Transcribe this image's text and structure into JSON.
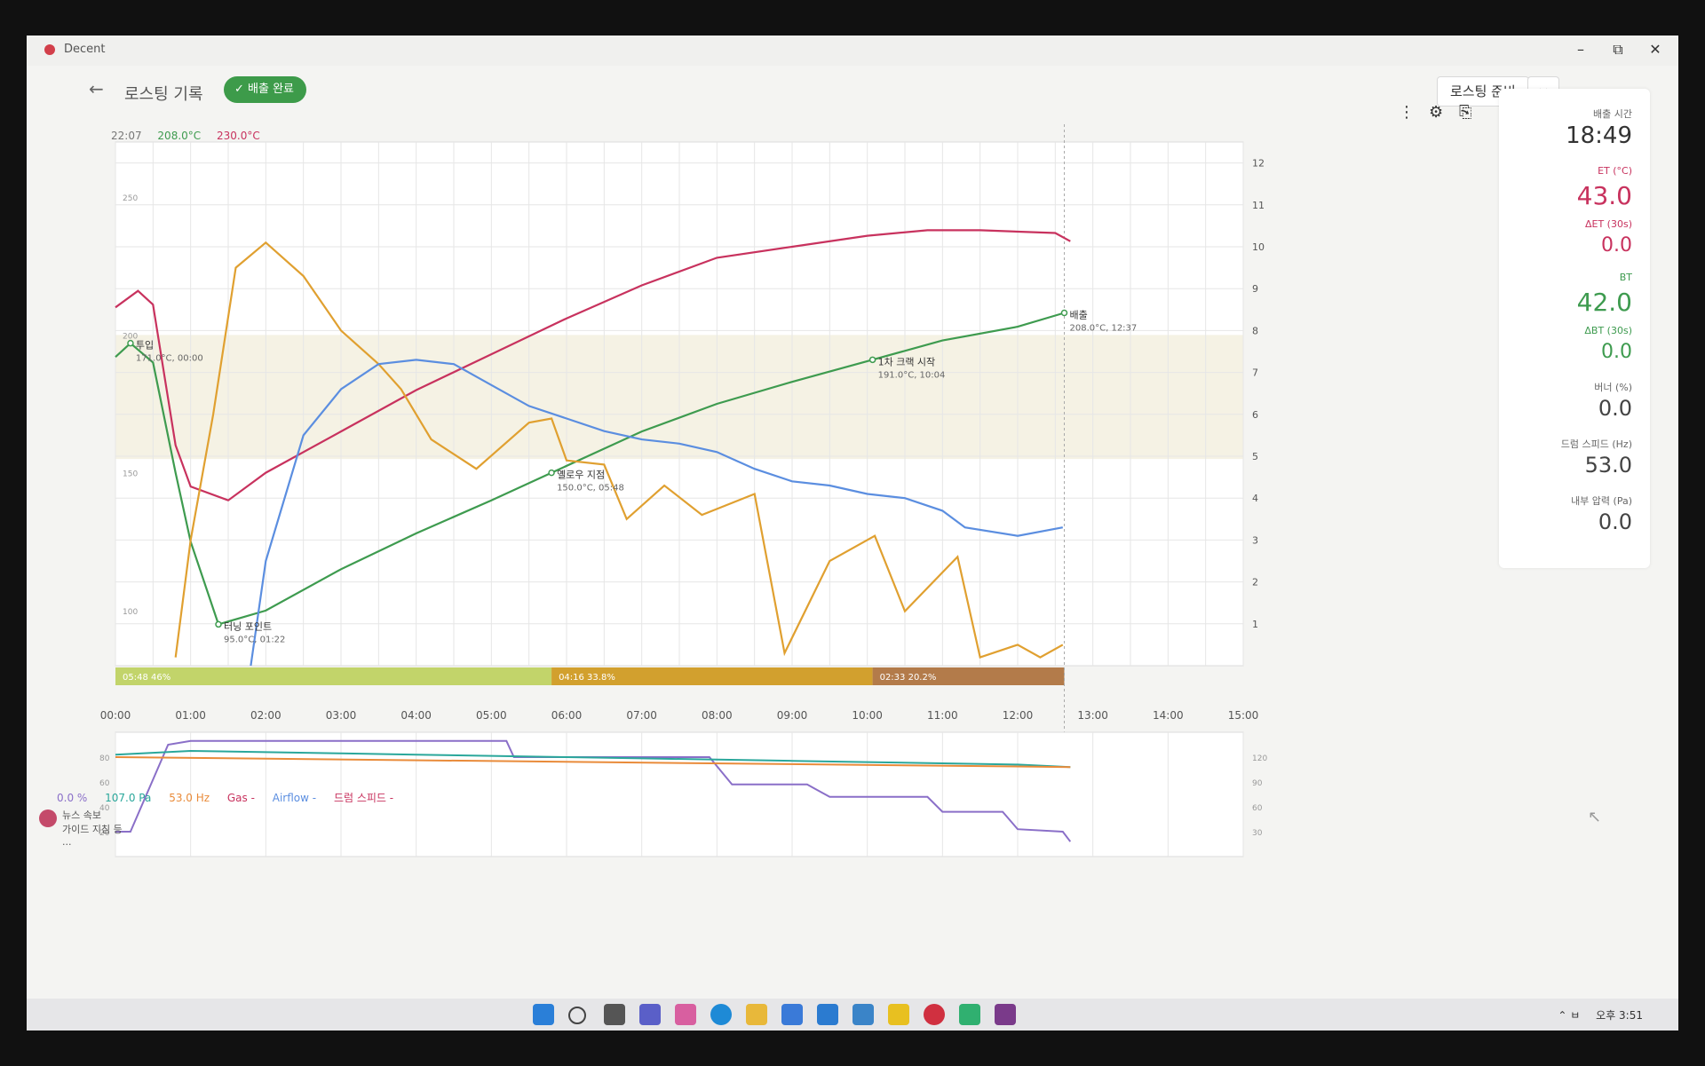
{
  "app": {
    "title": "Decent"
  },
  "window_controls": {
    "minimize": "–",
    "maximize": "⧉",
    "close": "✕"
  },
  "header": {
    "back": "←",
    "title": "로스팅 기록",
    "badge": "배출 완료",
    "prep_button": "로스팅 준비",
    "expand_button": "‹ ›"
  },
  "readout": {
    "time": "22:07",
    "et": "208.0°C",
    "bt": "230.0°C"
  },
  "toolbar": {
    "more": "⋮",
    "settings": "⚙",
    "export": "⎘"
  },
  "panel": {
    "roast_time_label": "배출 시간",
    "roast_time": "18:49",
    "et_label": "ET (°C)",
    "et": "43.0",
    "det_label": "ΔET (30s)",
    "det": "0.0",
    "bt_label": "BT",
    "bt": "42.0",
    "dbt_label": "ΔBT (30s)",
    "dbt": "0.0",
    "burner_label": "버너 (%)",
    "burner": "0.0",
    "drum_label": "드럼 스피드 (Hz)",
    "drum": "53.0",
    "pressure_label": "내부 압력 (Pa)",
    "pressure": "0.0"
  },
  "phases": [
    {
      "label": "05:48",
      "pct": "46%",
      "color": "#c2d46a"
    },
    {
      "label": "04:16",
      "pct": "33.8%",
      "color": "#d2a02e"
    },
    {
      "label": "02:33",
      "pct": "20.2%",
      "color": "#b37b4a"
    }
  ],
  "annotations": {
    "turning_point": {
      "title": "터닝 포인트",
      "detail": "95.0°C, 01:22"
    },
    "yellow_point": {
      "title": "옐로우 지점",
      "detail": "150.0°C, 05:48"
    },
    "first_crack": {
      "title": "1차 크랙 시작",
      "detail": "191.0°C, 10:04"
    },
    "drop": {
      "title": "배출",
      "detail": "208.0°C, 12:37"
    },
    "charge": {
      "title": "투입",
      "detail": "171.0°C, 00:00"
    }
  },
  "legend": {
    "burner": "0.0 %",
    "pressure": "107.0 Pa",
    "drum": "53.0 Hz",
    "gas": "Gas -",
    "airflow": "Airflow -",
    "drum_speed": "드럼 스피드 -"
  },
  "notification": {
    "line1": "뉴스 속보",
    "line2": "가이드 지침 등 ..."
  },
  "tray": {
    "lang": "ㅂ",
    "time": "오후 3:51"
  },
  "colors": {
    "et": "#c8325e",
    "bt": "#3e9b4f",
    "ror": "#e0a030",
    "fan": "#5b8ee0",
    "burner": "#8a6fc8",
    "pressure": "#2aa79b",
    "drum": "#e98b3a"
  },
  "chart_data": [
    {
      "type": "line",
      "x_ticks": [
        "00:00",
        "01:00",
        "02:00",
        "03:00",
        "04:00",
        "05:00",
        "06:00",
        "07:00",
        "08:00",
        "09:00",
        "10:00",
        "11:00",
        "12:00",
        "13:00",
        "14:00",
        "15:00"
      ],
      "y_left_ticks": [
        "100",
        "150",
        "200",
        "250"
      ],
      "y_right_ticks": [
        "1",
        "2",
        "3",
        "4",
        "5",
        "6",
        "7",
        "8",
        "9",
        "10",
        "11",
        "12"
      ],
      "xlim": [
        0,
        15
      ],
      "ylim": [
        80,
        270
      ],
      "ylim_right": [
        0,
        12.5
      ],
      "series": [
        {
          "key": "et",
          "axis": "left",
          "points": [
            [
              0,
              210
            ],
            [
              0.3,
              216
            ],
            [
              0.5,
              211
            ],
            [
              0.8,
              160
            ],
            [
              1,
              145
            ],
            [
              1.5,
              140
            ],
            [
              2,
              150
            ],
            [
              3,
              165
            ],
            [
              4,
              180
            ],
            [
              5,
              193
            ],
            [
              6,
              206
            ],
            [
              7,
              218
            ],
            [
              8,
              228
            ],
            [
              9,
              232
            ],
            [
              10,
              236
            ],
            [
              10.8,
              238
            ],
            [
              11.5,
              238
            ],
            [
              12.5,
              237
            ],
            [
              12.7,
              234
            ]
          ]
        },
        {
          "key": "bt",
          "axis": "left",
          "points": [
            [
              0,
              192
            ],
            [
              0.2,
              197
            ],
            [
              0.5,
              190
            ],
            [
              0.8,
              150
            ],
            [
              1,
              125
            ],
            [
              1.37,
              95
            ],
            [
              2,
              100
            ],
            [
              3,
              115
            ],
            [
              4,
              128
            ],
            [
              5,
              140
            ],
            [
              5.8,
              150
            ],
            [
              7,
              165
            ],
            [
              8,
              175
            ],
            [
              9,
              183
            ],
            [
              10.07,
              191
            ],
            [
              11,
              198
            ],
            [
              12,
              203
            ],
            [
              12.62,
              208
            ]
          ]
        },
        {
          "key": "ror",
          "axis": "right",
          "points": [
            [
              0.8,
              0.2
            ],
            [
              1,
              3
            ],
            [
              1.3,
              6
            ],
            [
              1.6,
              9.5
            ],
            [
              2,
              10.1
            ],
            [
              2.5,
              9.3
            ],
            [
              3,
              8
            ],
            [
              3.5,
              7.2
            ],
            [
              3.8,
              6.6
            ],
            [
              4.2,
              5.4
            ],
            [
              4.8,
              4.7
            ],
            [
              5.5,
              5.8
            ],
            [
              5.8,
              5.9
            ],
            [
              6,
              4.9
            ],
            [
              6.5,
              4.8
            ],
            [
              6.8,
              3.5
            ],
            [
              7.3,
              4.3
            ],
            [
              7.8,
              3.6
            ],
            [
              8.5,
              4.1
            ],
            [
              8.9,
              0.3
            ],
            [
              9.5,
              2.5
            ],
            [
              10.1,
              3.1
            ],
            [
              10.5,
              1.3
            ],
            [
              11.2,
              2.6
            ],
            [
              11.5,
              0.2
            ],
            [
              12,
              0.5
            ],
            [
              12.3,
              0.2
            ],
            [
              12.6,
              0.5
            ]
          ]
        },
        {
          "key": "fan",
          "axis": "right",
          "points": [
            [
              1.8,
              0
            ],
            [
              2,
              2.5
            ],
            [
              2.5,
              5.5
            ],
            [
              3,
              6.6
            ],
            [
              3.5,
              7.2
            ],
            [
              4,
              7.3
            ],
            [
              4.5,
              7.2
            ],
            [
              5,
              6.7
            ],
            [
              5.5,
              6.2
            ],
            [
              6,
              5.9
            ],
            [
              6.5,
              5.6
            ],
            [
              7,
              5.4
            ],
            [
              7.5,
              5.3
            ],
            [
              8,
              5.1
            ],
            [
              8.5,
              4.7
            ],
            [
              9,
              4.4
            ],
            [
              9.5,
              4.3
            ],
            [
              10,
              4.1
            ],
            [
              10.5,
              4.0
            ],
            [
              11,
              3.7
            ],
            [
              11.3,
              3.3
            ],
            [
              12,
              3.1
            ],
            [
              12.6,
              3.3
            ]
          ]
        }
      ]
    },
    {
      "type": "line",
      "x_ticks": [
        "00:00",
        "01:00",
        "02:00",
        "03:00",
        "04:00",
        "05:00",
        "06:00",
        "07:00",
        "08:00",
        "09:00",
        "10:00",
        "11:00",
        "12:00",
        "13:00",
        "14:00",
        "15:00"
      ],
      "y_left_ticks": [
        "20",
        "40",
        "60",
        "80"
      ],
      "y_right_ticks": [
        "30",
        "60",
        "90",
        "120"
      ],
      "xlim": [
        0,
        15
      ],
      "ylim": [
        0,
        100
      ],
      "series": [
        {
          "key": "burner",
          "points": [
            [
              0,
              20
            ],
            [
              0.2,
              20
            ],
            [
              0.7,
              90
            ],
            [
              1,
              93
            ],
            [
              5.2,
              93
            ],
            [
              5.3,
              80
            ],
            [
              7.9,
              80
            ],
            [
              8.2,
              58
            ],
            [
              9.2,
              58
            ],
            [
              9.5,
              48
            ],
            [
              10.8,
              48
            ],
            [
              11,
              36
            ],
            [
              11.8,
              36
            ],
            [
              12,
              22
            ],
            [
              12.6,
              20
            ],
            [
              12.7,
              12
            ]
          ]
        },
        {
          "key": "pressure",
          "points": [
            [
              0,
              82
            ],
            [
              1,
              85
            ],
            [
              2,
              84
            ],
            [
              3,
              83
            ],
            [
              4,
              82
            ],
            [
              5,
              81
            ],
            [
              6,
              80
            ],
            [
              7,
              79
            ],
            [
              8,
              78
            ],
            [
              9,
              77
            ],
            [
              10,
              76
            ],
            [
              11,
              75
            ],
            [
              12,
              74
            ],
            [
              12.7,
              72
            ]
          ]
        },
        {
          "key": "drum",
          "points": [
            [
              0,
              80
            ],
            [
              12.7,
              72
            ]
          ]
        }
      ]
    }
  ]
}
